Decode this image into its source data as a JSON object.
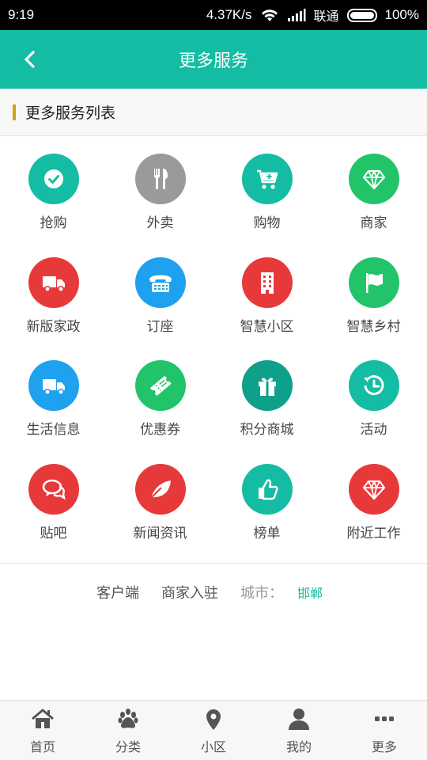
{
  "status_bar": {
    "time": "9:19",
    "speed": "4.37K/s",
    "carrier": "联通",
    "battery": "100%"
  },
  "header": {
    "title": "更多服务"
  },
  "section": {
    "title": "更多服务列表"
  },
  "services": [
    {
      "label": "抢购",
      "icon": "check-icon",
      "color": "#14bca3"
    },
    {
      "label": "外卖",
      "icon": "fork-knife-icon",
      "color": "#9a9a9a"
    },
    {
      "label": "购物",
      "icon": "shopping-cart-icon",
      "color": "#14bca3"
    },
    {
      "label": "商家",
      "icon": "diamond-icon",
      "color": "#22c46a"
    },
    {
      "label": "新版家政",
      "icon": "truck-icon",
      "color": "#e8393a"
    },
    {
      "label": "订座",
      "icon": "telephone-icon",
      "color": "#1ea1ee"
    },
    {
      "label": "智慧小区",
      "icon": "building-icon",
      "color": "#e8393a"
    },
    {
      "label": "智慧乡村",
      "icon": "flag-icon",
      "color": "#22c46a"
    },
    {
      "label": "生活信息",
      "icon": "truck-icon",
      "color": "#1ea1ee"
    },
    {
      "label": "优惠券",
      "icon": "ticket-icon",
      "color": "#22c46a"
    },
    {
      "label": "积分商城",
      "icon": "gift-icon",
      "color": "#0fa08b"
    },
    {
      "label": "活动",
      "icon": "history-icon",
      "color": "#14bca3"
    },
    {
      "label": "贴吧",
      "icon": "chat-icon",
      "color": "#e8393a"
    },
    {
      "label": "新闻资讯",
      "icon": "leaf-icon",
      "color": "#e8393a"
    },
    {
      "label": "榜单",
      "icon": "thumbs-up-icon",
      "color": "#14bca3"
    },
    {
      "label": "附近工作",
      "icon": "diamond-icon",
      "color": "#e8393a"
    }
  ],
  "footer": {
    "client": "客户端",
    "merchant_join": "商家入驻",
    "city_label": "城市：",
    "city_value": "邯郸"
  },
  "tabs": [
    {
      "label": "首页",
      "icon": "home-icon"
    },
    {
      "label": "分类",
      "icon": "paw-icon"
    },
    {
      "label": "小区",
      "icon": "location-pin-icon"
    },
    {
      "label": "我的",
      "icon": "user-icon"
    },
    {
      "label": "更多",
      "icon": "more-dots-icon"
    }
  ]
}
